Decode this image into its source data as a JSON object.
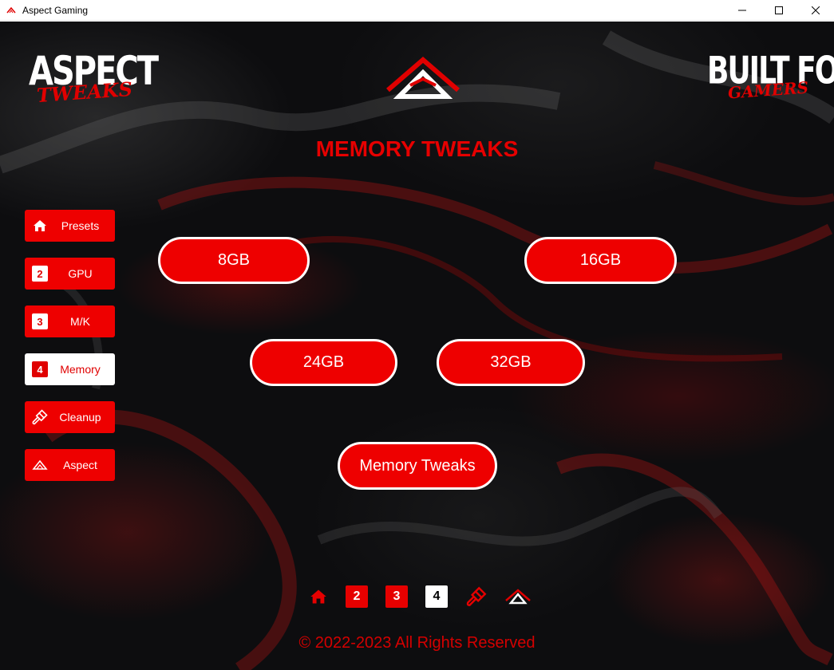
{
  "window": {
    "title": "Aspect Gaming",
    "controls": [
      "minimize-icon",
      "maximize-icon",
      "close-icon"
    ]
  },
  "logos": {
    "left": {
      "line1": "ASPECT",
      "line2": "TWEAKS"
    },
    "right": {
      "line1": "BUILT FOR",
      "line2": "GAMERS"
    }
  },
  "page_title": "MEMORY TWEAKS",
  "sidebar": {
    "items": [
      {
        "label": "Presets",
        "icon": "home-icon",
        "badge": ""
      },
      {
        "label": "GPU",
        "icon": "number-badge",
        "badge": "2"
      },
      {
        "label": "M/K",
        "icon": "number-badge",
        "badge": "3"
      },
      {
        "label": "Memory",
        "icon": "number-badge",
        "badge": "4",
        "active": true
      },
      {
        "label": "Cleanup",
        "icon": "brush-icon",
        "badge": ""
      },
      {
        "label": "Aspect",
        "icon": "aspect-logo-icon",
        "badge": ""
      }
    ]
  },
  "options": {
    "b8": "8GB",
    "b16": "16GB",
    "b24": "24GB",
    "b32": "32GB",
    "main": "Memory Tweaks"
  },
  "bottom_nav": {
    "items": [
      {
        "icon": "home-icon",
        "label": ""
      },
      {
        "icon": "number-badge",
        "label": "2"
      },
      {
        "icon": "number-badge",
        "label": "3"
      },
      {
        "icon": "number-badge",
        "label": "4",
        "active": true
      },
      {
        "icon": "brush-icon",
        "label": ""
      },
      {
        "icon": "aspect-logo-icon",
        "label": ""
      }
    ]
  },
  "footer": "© 2022-2023 All Rights Reserved",
  "colors": {
    "accent": "#ee0000",
    "background": "#0d0d0f",
    "text": "#ffffff"
  }
}
